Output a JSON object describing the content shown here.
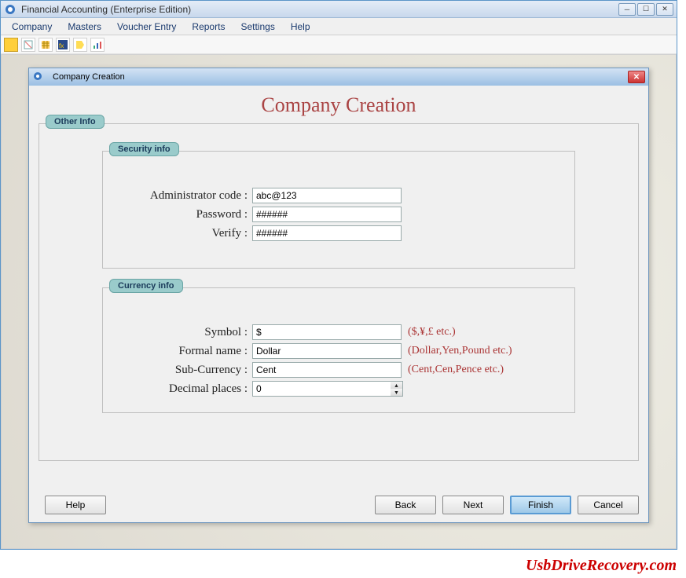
{
  "window": {
    "title": "Financial Accounting (Enterprise Edition)"
  },
  "menu": {
    "items": [
      "Company",
      "Masters",
      "Voucher Entry",
      "Reports",
      "Settings",
      "Help"
    ]
  },
  "toolbar": {
    "icons": [
      "folder-open",
      "edit",
      "table",
      "fx",
      "tag",
      "chart"
    ]
  },
  "dialog": {
    "title": "Company Creation",
    "heading": "Company Creation",
    "other_info_label": "Other Info",
    "security_label": "Security info",
    "currency_label": "Currency info",
    "security": {
      "admin_code_label": "Administrator code :",
      "admin_code_value": "abc@123",
      "password_label": "Password :",
      "password_value": "######",
      "verify_label": "Verify :",
      "verify_value": "######"
    },
    "currency": {
      "symbol_label": "Symbol :",
      "symbol_value": "$",
      "symbol_hint": "($,¥,£ etc.)",
      "formal_name_label": "Formal name :",
      "formal_name_value": "Dollar",
      "formal_name_hint": "(Dollar,Yen,Pound etc.)",
      "sub_currency_label": "Sub-Currency :",
      "sub_currency_value": "Cent",
      "sub_currency_hint": "(Cent,Cen,Pence etc.)",
      "decimal_places_label": "Decimal places :",
      "decimal_places_value": "0"
    },
    "buttons": {
      "help": "Help",
      "back": "Back",
      "next": "Next",
      "finish": "Finish",
      "cancel": "Cancel"
    }
  },
  "watermark": "UsbDriveRecovery.com"
}
